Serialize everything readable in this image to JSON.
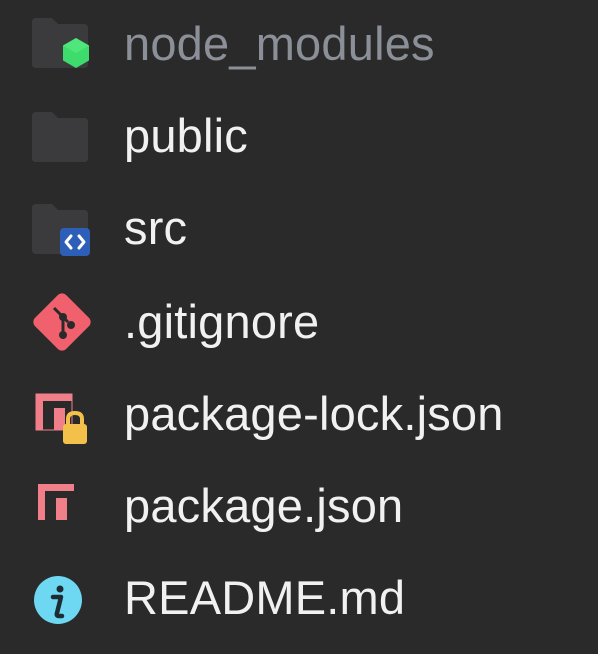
{
  "explorer": {
    "items": [
      {
        "label": "node_modules",
        "type": "folder",
        "icon": "folder-node-icon",
        "dimmed": true
      },
      {
        "label": "public",
        "type": "folder",
        "icon": "folder-icon"
      },
      {
        "label": "src",
        "type": "folder",
        "icon": "folder-src-icon"
      },
      {
        "label": ".gitignore",
        "type": "file",
        "icon": "git-icon"
      },
      {
        "label": "package-lock.json",
        "type": "file",
        "icon": "npm-lock-icon"
      },
      {
        "label": "package.json",
        "type": "file",
        "icon": "npm-icon"
      },
      {
        "label": "README.md",
        "type": "file",
        "icon": "info-icon"
      }
    ]
  },
  "colors": {
    "background": "#2a2a2a",
    "folder": "#3b3b3d",
    "node_green": "#3ddc6c",
    "src_blue": "#2e5fb8",
    "git_red": "#f0616d",
    "npm_red": "#f07f8a",
    "lock_yellow": "#f3c04a",
    "info_cyan": "#6ed7f2",
    "text": "#f1f1f1",
    "text_dim": "#8b8f97"
  }
}
